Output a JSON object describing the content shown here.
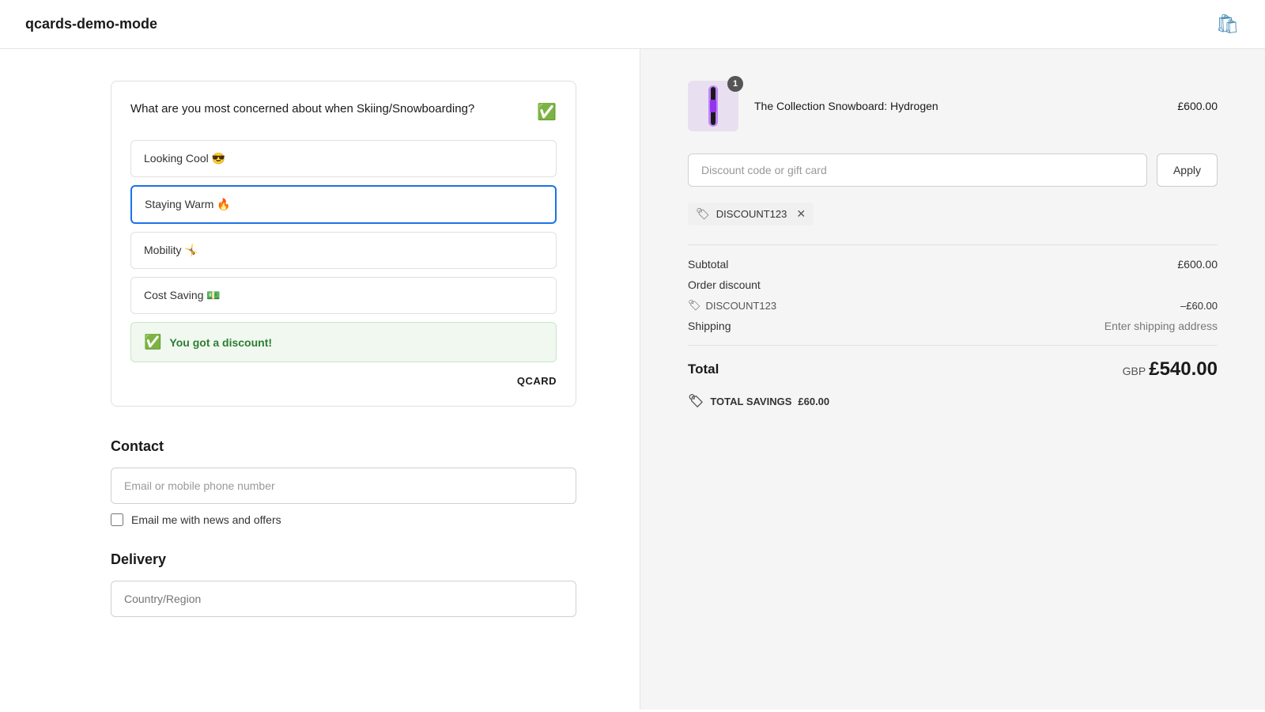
{
  "header": {
    "title": "qcards-demo-mode",
    "cart_icon": "🛍"
  },
  "qcard": {
    "question": "What are you most concerned about when Skiing/Snowboarding?",
    "check_icon": "✅",
    "options": [
      {
        "id": "looking-cool",
        "label": "Looking Cool 😎",
        "selected": false
      },
      {
        "id": "staying-warm",
        "label": "Staying Warm 🔥",
        "selected": true
      },
      {
        "id": "mobility",
        "label": "Mobility 🤸",
        "selected": false
      },
      {
        "id": "cost-saving",
        "label": "Cost Saving 💵",
        "selected": false
      }
    ],
    "discount_banner": "You got a discount!",
    "branding": "QCARD"
  },
  "contact": {
    "section_title": "Contact",
    "email_placeholder": "Email or mobile phone number",
    "checkbox_label": "Email me with news and offers"
  },
  "delivery": {
    "section_title": "Delivery",
    "country_placeholder": "Country/Region"
  },
  "sidebar": {
    "product": {
      "name": "The Collection Snowboard: Hydrogen",
      "price": "£600.00",
      "badge": "1"
    },
    "discount_input_placeholder": "Discount code or gift card",
    "apply_button": "Apply",
    "applied_code": "DISCOUNT123",
    "subtotal_label": "Subtotal",
    "subtotal_value": "£600.00",
    "order_discount_label": "Order discount",
    "discount_code_display": "DISCOUNT123",
    "discount_value": "–£60.00",
    "shipping_label": "Shipping",
    "shipping_value": "Enter shipping address",
    "total_label": "Total",
    "total_currency": "GBP",
    "total_value": "£540.00",
    "savings_label": "TOTAL SAVINGS",
    "savings_value": "£60.00"
  }
}
